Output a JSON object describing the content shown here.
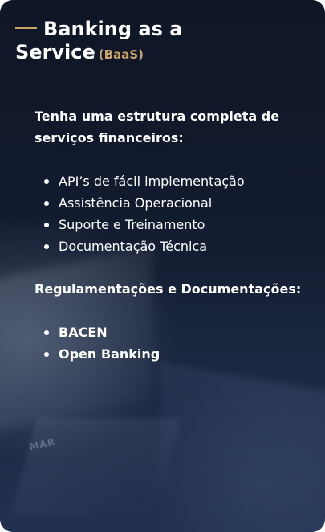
{
  "card": {
    "title_line1": "Banking as a",
    "title_line2": "Service",
    "title_abbr": "(BaaS)",
    "accent_color": "#c9a36a",
    "background_mark": "MAR"
  },
  "services": {
    "heading": "Tenha uma estrutura completa de serviços financeiros:",
    "items": [
      "API’s de fácil implementação",
      "Assistência Operacional",
      "Suporte e Treinamento",
      "Documentação Técnica"
    ]
  },
  "regulations": {
    "heading": "Regulamentações e Documentações:",
    "items": [
      "BACEN",
      "Open Banking"
    ]
  }
}
